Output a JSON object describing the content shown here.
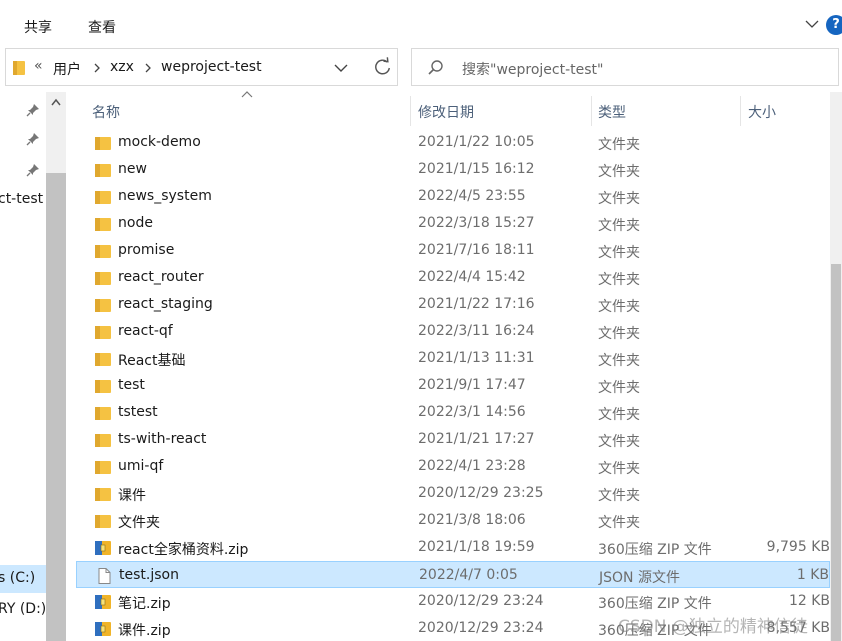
{
  "ribbon": {
    "tabs": [
      "共享",
      "查看"
    ]
  },
  "address": {
    "overflow": "«",
    "segments": [
      "用户",
      "xzx",
      "weproject-test"
    ]
  },
  "search": {
    "placeholder": "搜索\"weproject-test\""
  },
  "nav": {
    "items": [
      "ct-test",
      "s (C:)",
      "RY (D:)"
    ]
  },
  "columns": {
    "name": "名称",
    "date": "修改日期",
    "type": "类型",
    "size": "大小"
  },
  "files": [
    {
      "name": "mock-demo",
      "date": "2021/1/22 10:05",
      "type": "文件夹",
      "size": "",
      "icon": "folder-icon"
    },
    {
      "name": "new",
      "date": "2021/1/15 16:12",
      "type": "文件夹",
      "size": "",
      "icon": "folder-icon"
    },
    {
      "name": "news_system",
      "date": "2022/4/5 23:55",
      "type": "文件夹",
      "size": "",
      "icon": "folder-icon"
    },
    {
      "name": "node",
      "date": "2022/3/18 15:27",
      "type": "文件夹",
      "size": "",
      "icon": "folder-icon"
    },
    {
      "name": "promise",
      "date": "2021/7/16 18:11",
      "type": "文件夹",
      "size": "",
      "icon": "folder-icon"
    },
    {
      "name": "react_router",
      "date": "2022/4/4 15:42",
      "type": "文件夹",
      "size": "",
      "icon": "folder-icon"
    },
    {
      "name": "react_staging",
      "date": "2021/1/22 17:16",
      "type": "文件夹",
      "size": "",
      "icon": "folder-icon"
    },
    {
      "name": "react-qf",
      "date": "2022/3/11 16:24",
      "type": "文件夹",
      "size": "",
      "icon": "folder-icon"
    },
    {
      "name": "React基础",
      "date": "2021/1/13 11:31",
      "type": "文件夹",
      "size": "",
      "icon": "folder-icon"
    },
    {
      "name": "test",
      "date": "2021/9/1 17:47",
      "type": "文件夹",
      "size": "",
      "icon": "folder-icon"
    },
    {
      "name": "tstest",
      "date": "2022/3/1 14:56",
      "type": "文件夹",
      "size": "",
      "icon": "folder-icon"
    },
    {
      "name": "ts-with-react",
      "date": "2021/1/21 17:27",
      "type": "文件夹",
      "size": "",
      "icon": "folder-icon"
    },
    {
      "name": "umi-qf",
      "date": "2022/4/1 23:28",
      "type": "文件夹",
      "size": "",
      "icon": "folder-icon"
    },
    {
      "name": "课件",
      "date": "2020/12/29 23:25",
      "type": "文件夹",
      "size": "",
      "icon": "folder-icon"
    },
    {
      "name": "文件夹",
      "date": "2021/3/8 18:06",
      "type": "文件夹",
      "size": "",
      "icon": "folder-icon"
    },
    {
      "name": "react全家桶资料.zip",
      "date": "2021/1/18 19:59",
      "type": "360压缩 ZIP 文件",
      "size": "9,795 KB",
      "icon": "zip-icon"
    },
    {
      "name": "test.json",
      "date": "2022/4/7 0:05",
      "type": "JSON 源文件",
      "size": "1 KB",
      "icon": "document-icon",
      "selected": true
    },
    {
      "name": "笔记.zip",
      "date": "2020/12/29 23:24",
      "type": "360压缩 ZIP 文件",
      "size": "12 KB",
      "icon": "zip-icon"
    },
    {
      "name": "课件.zip",
      "date": "2020/12/29 23:24",
      "type": "360压缩 ZIP 文件",
      "size": "8,557 KB",
      "icon": "zip-icon"
    }
  ],
  "watermark": "CSDN @独立的精神信徒",
  "colors": {
    "folder": "#f5c242",
    "selection": "#cce8ff",
    "accent": "#1565c0"
  }
}
